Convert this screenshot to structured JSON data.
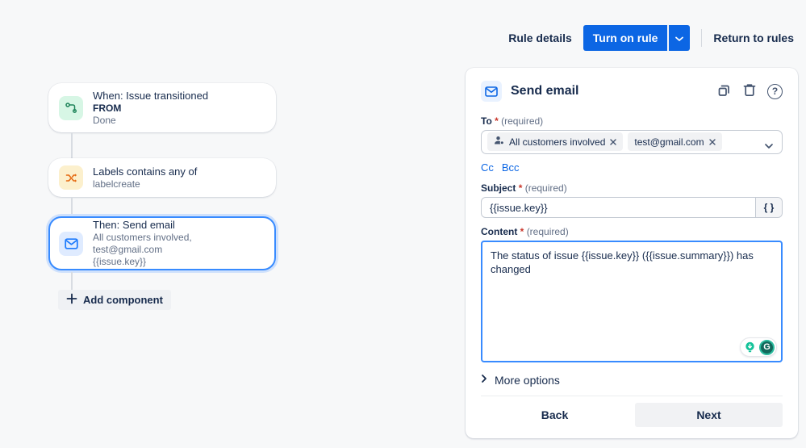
{
  "header": {
    "rule_details_label": "Rule details",
    "turn_on_rule_label": "Turn on rule",
    "return_to_rules_label": "Return to rules"
  },
  "flow": {
    "cards": [
      {
        "title": "When: Issue transitioned",
        "line2": "FROM",
        "line3": "Done"
      },
      {
        "title": "Labels contains any of",
        "line2": "labelcreate"
      },
      {
        "title": "Then: Send email",
        "line2": "All customers involved, test@gmail.com",
        "line3": "{{issue.key}}"
      }
    ],
    "add_component_label": "Add component"
  },
  "panel": {
    "title": "Send email",
    "to_field": {
      "label": "To",
      "star": "*",
      "required": "(required)",
      "chips": [
        {
          "label": "All customers involved"
        },
        {
          "label": "test@gmail.com"
        }
      ]
    },
    "cc_label": "Cc",
    "bcc_label": "Bcc",
    "subject_field": {
      "label": "Subject",
      "star": "*",
      "required": "(required)",
      "value": "{{issue.key}}",
      "addon": "{ }"
    },
    "content_field": {
      "label": "Content",
      "star": "*",
      "required": "(required)",
      "value": "The status of issue {{issue.key}} ({{issue.summary}}) has changed"
    },
    "more_options_label": "More options",
    "back_label": "Back",
    "next_label": "Next",
    "icons": {
      "help_glyph": "?",
      "grammarly_glyph": "G"
    }
  },
  "colors": {
    "accent_blue": "#0C66E4",
    "selected_border": "#388BFF",
    "trigger_green": "#1F845A",
    "condition_orange": "#E56910",
    "background": "#F7F8F9"
  }
}
